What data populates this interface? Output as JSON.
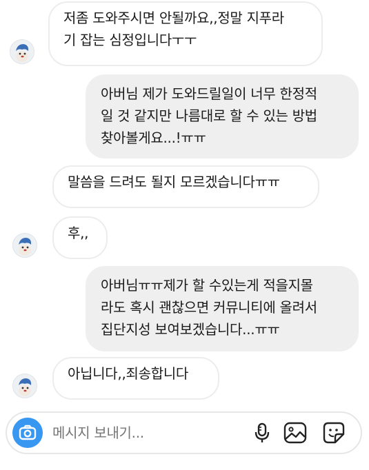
{
  "messages": [
    {
      "direction": "incoming",
      "text": "저좀 도와주시면 안될까요,,정말 지푸라\n기 잡는 심정입니다ㅜㅜ",
      "avatar": "avatar-icon"
    },
    {
      "direction": "outgoing",
      "text": "아버님 제가 도와드릴일이 너무 한정적\n일 것 같지만 나름대로 할 수 있는 방법\n찾아볼게요...!ㅠㅠ"
    },
    {
      "direction": "incoming",
      "text": "말씀을 드려도 될지 모르겠습니다ㅠㅠ"
    },
    {
      "direction": "incoming",
      "text": "후,,",
      "avatar": "avatar-icon"
    },
    {
      "direction": "outgoing",
      "text": "아버님ㅠㅠ제가 할 수있는게 적을지몰\n라도 혹시 괜찮으면 커뮤니티에 올려서\n집단지성 보여보겠습니다...ㅠㅠ"
    },
    {
      "direction": "incoming",
      "text": "아닙니다,,죄송합니다",
      "avatar": "avatar-icon"
    }
  ],
  "composer": {
    "placeholder": "메시지 보내기...",
    "camera_icon": "camera-icon",
    "mic_icon": "microphone-icon",
    "gallery_icon": "gallery-icon",
    "sticker_icon": "sticker-icon",
    "accent_color": "#3897f0"
  }
}
